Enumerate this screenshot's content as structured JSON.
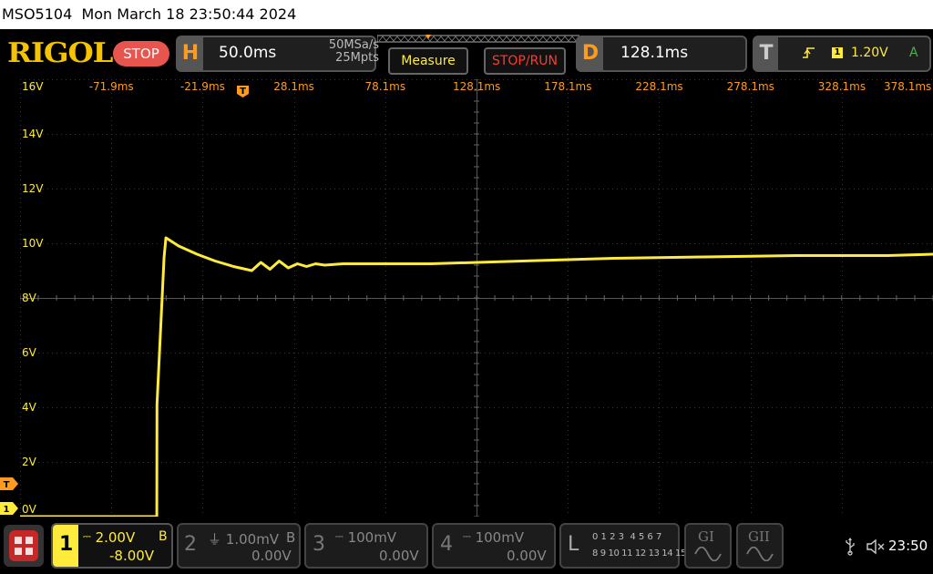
{
  "title_bar": {
    "model": "MSO5104",
    "datetime": "Mon March 18 23:50:44 2024"
  },
  "brand": {
    "logo": "RIGOL",
    "run_state": "STOP"
  },
  "horizontal": {
    "letter": "H",
    "timebase": "50.0ms",
    "sample_rate": "50MSa/s",
    "memory_depth": "25Mpts"
  },
  "buttons": {
    "measure": "Measure",
    "stop_run": "STOP/RUN"
  },
  "delay": {
    "letter": "D",
    "value": "128.1ms"
  },
  "trigger": {
    "letter": "T",
    "source": "1",
    "level": "1.20V",
    "mode": "A",
    "edge_icon": "rising-edge-icon"
  },
  "time_labels": [
    "-71.9ms",
    "-21.9ms",
    "28.1ms",
    "78.1ms",
    "128.1ms",
    "178.1ms",
    "228.1ms",
    "278.1ms",
    "328.1ms",
    "378.1ms"
  ],
  "voltage_labels": [
    "16V",
    "14V",
    "12V",
    "10V",
    "8V",
    "6V",
    "4V",
    "2V",
    "0V"
  ],
  "markers": {
    "trigger_time": "T",
    "trigger_level": "T",
    "channel1": "1"
  },
  "channels": [
    {
      "num": "1",
      "scale": "2.00V",
      "bandwidth": "B",
      "offset": "-8.00V",
      "coupling_icon": "dc-coupling-icon"
    },
    {
      "num": "2",
      "scale": "1.00mV",
      "bandwidth": "B",
      "offset": "0.00V",
      "coupling_icon": "ground-coupling-icon"
    },
    {
      "num": "3",
      "scale": "100mV",
      "bandwidth": "",
      "offset": "0.00V",
      "coupling_icon": "dc-coupling-icon"
    },
    {
      "num": "4",
      "scale": "100mV",
      "bandwidth": "",
      "offset": "0.00V",
      "coupling_icon": "dc-coupling-icon"
    }
  ],
  "logic": {
    "letter": "L",
    "row1": "0 1 2 3  4 5 6 7",
    "row2": "8 9 10 11 12 13 14 15"
  },
  "generators": [
    "GI",
    "GII"
  ],
  "status": {
    "clock": "23:50",
    "usb_icon": "usb-icon",
    "sound_icon": "speaker-muted-icon"
  },
  "colors": {
    "ch1": "#ffeb3b",
    "accent": "#ff9b1e",
    "stop": "#e8554e",
    "run_stop": "#ff3b30"
  },
  "chart_data": {
    "type": "line",
    "x_unit": "ms",
    "y_unit": "V",
    "xlim": [
      -96.9,
      403.1
    ],
    "ylim": [
      0,
      16
    ],
    "grid": true,
    "series": [
      {
        "x": [
          -96.9,
          -22,
          -21.9,
          -18,
          -17,
          -10,
          0,
          10,
          20,
          30,
          35,
          40,
          45,
          50,
          55,
          60,
          65,
          70,
          80,
          100,
          128.1,
          178.1,
          228.1,
          278.1,
          328.1,
          378.1,
          403.1
        ],
        "values": [
          0,
          0,
          4.1,
          9.5,
          10.2,
          9.9,
          9.6,
          9.35,
          9.15,
          9.0,
          9.3,
          9.05,
          9.35,
          9.1,
          9.25,
          9.15,
          9.25,
          9.2,
          9.25,
          9.25,
          9.25,
          9.35,
          9.45,
          9.5,
          9.55,
          9.55,
          9.6
        ]
      }
    ]
  }
}
